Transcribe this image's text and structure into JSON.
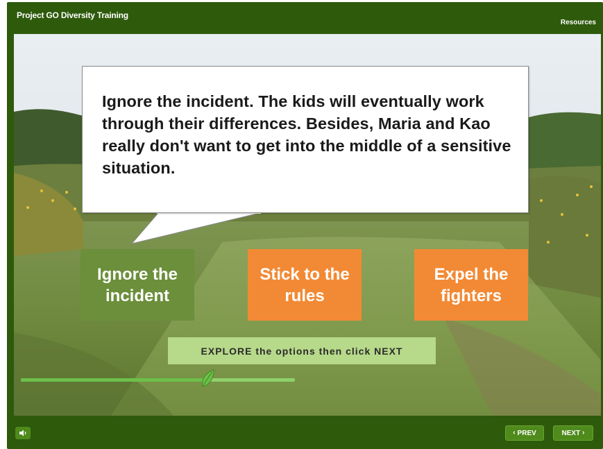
{
  "header": {
    "app_title": "Project GO Diversity Training",
    "resources_label": "Resources"
  },
  "scene": {
    "speech_text": "Ignore the incident. The kids will eventually work through their differences. Besides, Maria and Kao really don't want to get into the middle of a sensitive situation."
  },
  "options": [
    {
      "label": "Ignore the incident",
      "state": "selected",
      "color": "#6b8f3a"
    },
    {
      "label": "Stick to the rules",
      "state": "default",
      "color": "#f28a35"
    },
    {
      "label": "Expel the fighters",
      "state": "default",
      "color": "#f28a35"
    }
  ],
  "instruction": {
    "text": "EXPLORE the options then click NEXT"
  },
  "progress": {
    "value": 0.68
  },
  "footer": {
    "audio_icon": "speaker-icon",
    "prev_label": "PREV",
    "next_label": "NEXT",
    "prev_icon": "chevron-left-icon",
    "next_icon": "chevron-right-icon"
  },
  "colors": {
    "frame": "#2e5a0c",
    "option_selected": "#6b8f3a",
    "option_default": "#f28a35",
    "instruction_bg": "#b7d98a",
    "progress": "#8fd06a"
  }
}
